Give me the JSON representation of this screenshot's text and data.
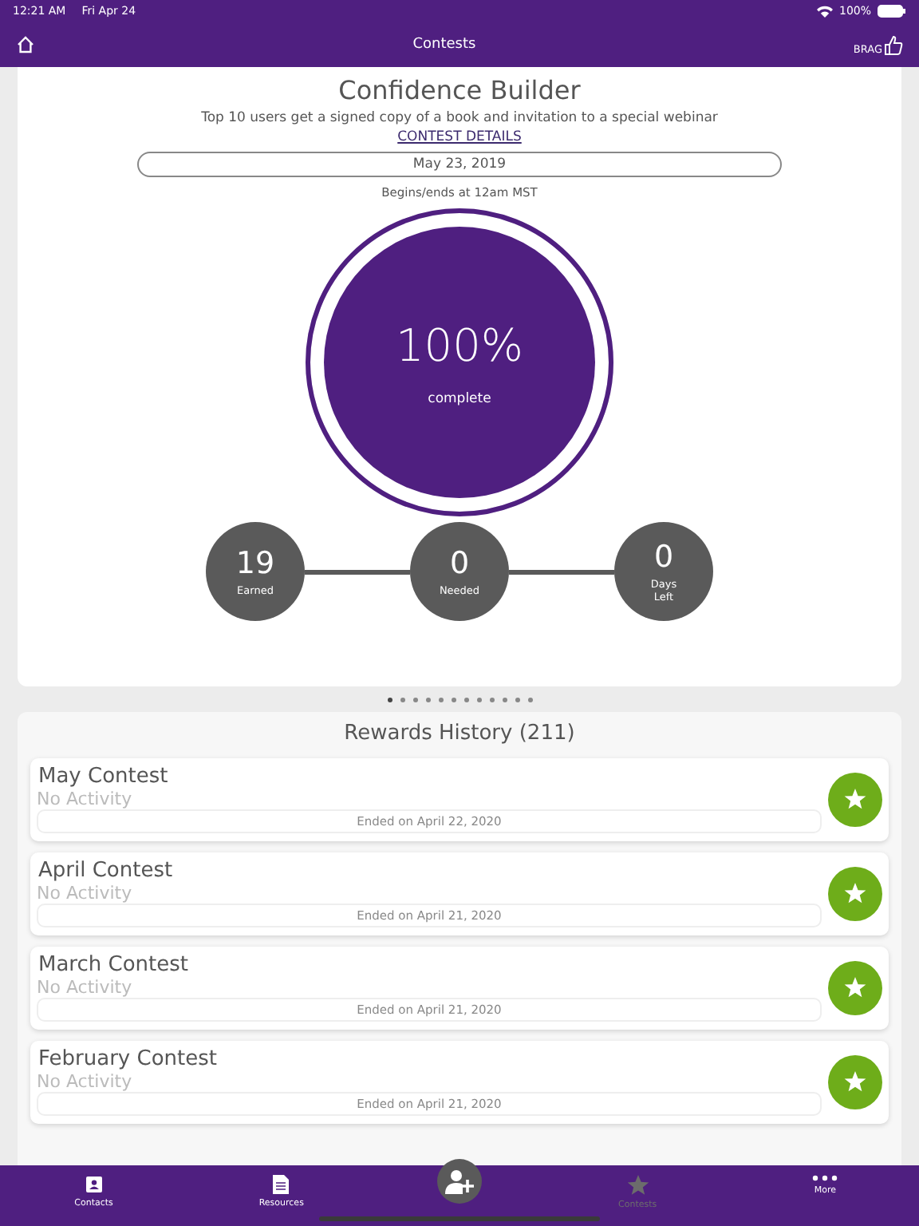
{
  "status_bar": {
    "time": "12:21 AM",
    "date": "Fri Apr 24",
    "battery": "100%"
  },
  "nav": {
    "title": "Contests",
    "brag": "BRAG"
  },
  "contest": {
    "title": "Confidence Builder",
    "description": "Top 10 users get a signed copy of a book and invitation to a special webinar",
    "link": "CONTEST DETAILS",
    "date": "May 23, 2019",
    "note": "Begins/ends at 12am MST",
    "percent": "100%",
    "percent_label": "complete",
    "level": 1,
    "stats": [
      {
        "value": "19",
        "label": "Earned"
      },
      {
        "value": "0",
        "label": "Needed"
      },
      {
        "value": "0",
        "label": "Days Left"
      }
    ]
  },
  "pager": [
    {
      "selected": true
    },
    {
      "selected": false
    },
    {
      "selected": false
    },
    {
      "selected": false
    },
    {
      "selected": false
    },
    {
      "selected": false
    },
    {
      "selected": false
    },
    {
      "selected": false
    },
    {
      "selected": false
    },
    {
      "selected": false
    },
    {
      "selected": false
    },
    {
      "selected": false
    }
  ],
  "rewards": {
    "title": "Rewards History (211)",
    "items": [
      {
        "name": "May Contest",
        "activity": "No Activity",
        "ended": "Ended on April 22, 2020"
      },
      {
        "name": "April Contest",
        "activity": "No Activity",
        "ended": "Ended on April 21, 2020"
      },
      {
        "name": "March Contest",
        "activity": "No Activity",
        "ended": "Ended on April 21, 2020"
      },
      {
        "name": "February Contest",
        "activity": "No Activity",
        "ended": "Ended on April 21, 2020"
      }
    ]
  },
  "tab_bar": [
    {
      "kind": "contacts",
      "label": "Contacts",
      "selected": false
    },
    {
      "kind": "resources",
      "label": "Resources",
      "selected": false
    },
    {
      "kind": "add"
    },
    {
      "kind": "contests",
      "label": "Contests",
      "selected": true
    },
    {
      "kind": "more",
      "label": "More",
      "selected": false
    }
  ]
}
